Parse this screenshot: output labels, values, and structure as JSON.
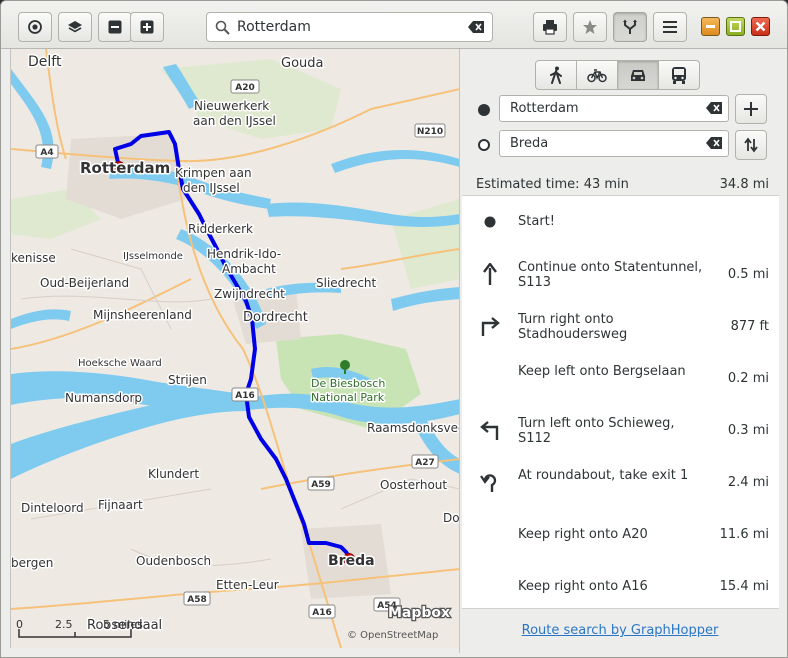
{
  "header": {
    "search_value": "Rotterdam",
    "icons": [
      "locate-icon",
      "layers-icon",
      "zoom-out-icon",
      "zoom-in-icon",
      "print-icon",
      "favorite-star-icon",
      "route-icon",
      "menu-icon"
    ]
  },
  "window_controls": [
    "minimize",
    "maximize",
    "close"
  ],
  "map": {
    "labels": {
      "delft": "Delft",
      "gouda": "Gouda",
      "nieuwerkerk1": "Nieuwerkerk",
      "nieuwerkerk2": "aan den IJssel",
      "rotterdam": "Rotterdam",
      "krimpen1": "Krimpen aan",
      "krimpen2": "den IJssel",
      "ridderkerk": "Ridderkerk",
      "kenisse": "kenisse",
      "hendrik1": "Hendrik-Ido-",
      "hendrik2": "Ambacht",
      "ijsselmonde": "IJsselmonde",
      "oudbeijerland": "Oud-Beijerland",
      "sliedrecht": "Sliedrecht",
      "zwijndrecht": "Zwijndrecht",
      "mijnsheerenland": "Mijnsheerenland",
      "dordrecht": "Dordrecht",
      "hoeksche": "Hoeksche Waard",
      "strijen": "Strijen",
      "biesbosch1": "De Biesbosch",
      "biesbosch2": "National Park",
      "numansdorp": "Numansdorp",
      "raamsdonksveer": "Raamsdonksveer",
      "klundert": "Klundert",
      "oosterhout": "Oosterhout",
      "dinteloord": "Dinteloord",
      "fijnaart": "Fijnaart",
      "do": "Do",
      "bergen": "bergen",
      "oudenbosch": "Oudenbosch",
      "breda": "Breda",
      "ettenleur": "Etten-Leur",
      "roosendaal": "Roosendaal"
    },
    "road_shields": {
      "a20": "A20",
      "a4": "A4",
      "n210": "N210",
      "a16a": "A16",
      "a27": "A27",
      "a59": "A59",
      "a58": "A58",
      "a16b": "A16",
      "a54": "A54"
    },
    "scale": {
      "t0": "0",
      "t1": "2.5",
      "t2": "5 miles"
    },
    "attribution_logo": "Mapbox",
    "attribution": "© OpenStreetMap"
  },
  "sidebar": {
    "modes": [
      {
        "name": "walk",
        "icon": "walk-icon"
      },
      {
        "name": "bike",
        "icon": "bike-icon"
      },
      {
        "name": "car",
        "icon": "car-icon",
        "active": true
      },
      {
        "name": "transit",
        "icon": "bus-icon"
      }
    ],
    "from_value": "Rotterdam",
    "to_value": "Breda",
    "estimated_time": "Estimated time: 43 min",
    "total_distance": "34.8 mi",
    "instructions": [
      {
        "text": "Start!",
        "distance": "",
        "icon": "start-dot-icon"
      },
      {
        "text": "Continue onto Statentunnel, S113",
        "distance": "0.5 mi",
        "icon": "arrow-straight-icon"
      },
      {
        "text": "Turn right onto Stadhoudersweg",
        "distance": "877 ft",
        "icon": "turn-right-icon"
      },
      {
        "text": "Keep left onto Bergselaan",
        "distance": "0.2 mi",
        "icon": ""
      },
      {
        "text": "Turn left onto Schieweg, S112",
        "distance": "0.3 mi",
        "icon": "turn-left-icon"
      },
      {
        "text": "At roundabout, take exit 1",
        "distance": "2.4 mi",
        "icon": "roundabout-icon"
      },
      {
        "text": "Keep right onto A20",
        "distance": "11.6 mi",
        "icon": ""
      },
      {
        "text": "Keep right onto A16",
        "distance": "15.4 mi",
        "icon": ""
      }
    ],
    "footer_link": "Route search by GraphHopper"
  },
  "colors": {
    "route": "#0000e6",
    "water": "#7fcbf0",
    "land": "#eee9e3",
    "park": "#c8e3b4",
    "marker": "#d40000"
  }
}
